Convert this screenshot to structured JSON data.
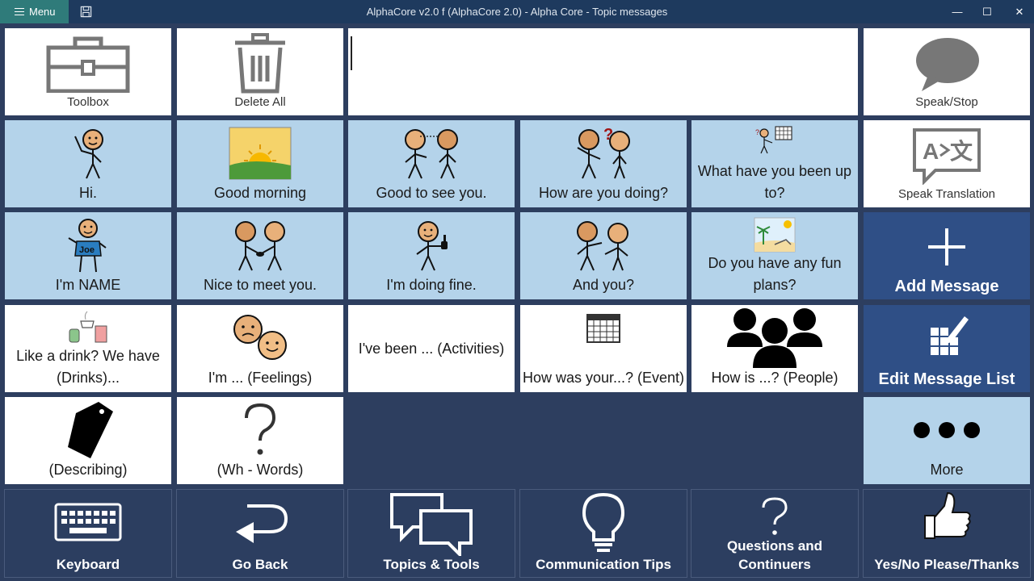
{
  "window": {
    "menu_label": "Menu",
    "title": "AlphaCore v2.0 f (AlphaCore 2.0) - Alpha Core - Topic messages",
    "minimize": "—",
    "maximize": "☐",
    "close": "✕"
  },
  "top_row": {
    "toolbox": "Toolbox",
    "delete_all": "Delete All",
    "message_text": "",
    "speak_stop": "Speak/Stop"
  },
  "side": {
    "speak_translation": "Speak Translation",
    "add_message": "Add Message",
    "edit_message_list": "Edit Message List",
    "more": "More"
  },
  "messages": {
    "hi": "Hi.",
    "good_morning": "Good morning",
    "good_to_see_you": "Good to see you.",
    "how_are_you": "How are you doing?",
    "what_have_you_been": "What have you been up to?",
    "im_name": "I'm NAME",
    "nice_to_meet": "Nice to meet you.",
    "doing_fine": "I'm doing fine.",
    "and_you": "And you?",
    "fun_plans": "Do you have any fun plans?",
    "like_drink": "Like a drink?  We have (Drinks)...",
    "feelings": "I'm ... (Feelings)",
    "activities": "I've been ...  (Activities)",
    "how_was_event": "How was your...? (Event)",
    "how_is_people": "How is ...?  (People)",
    "describing": "(Describing)",
    "wh_words": "(Wh - Words)",
    "joe_shirt": "Joe"
  },
  "bottom": {
    "keyboard": "Keyboard",
    "go_back": "Go Back",
    "topics_tools": "Topics & Tools",
    "comm_tips": "Communication Tips",
    "questions": "Questions and Continuers",
    "yes_no": "Yes/No Please/Thanks"
  }
}
